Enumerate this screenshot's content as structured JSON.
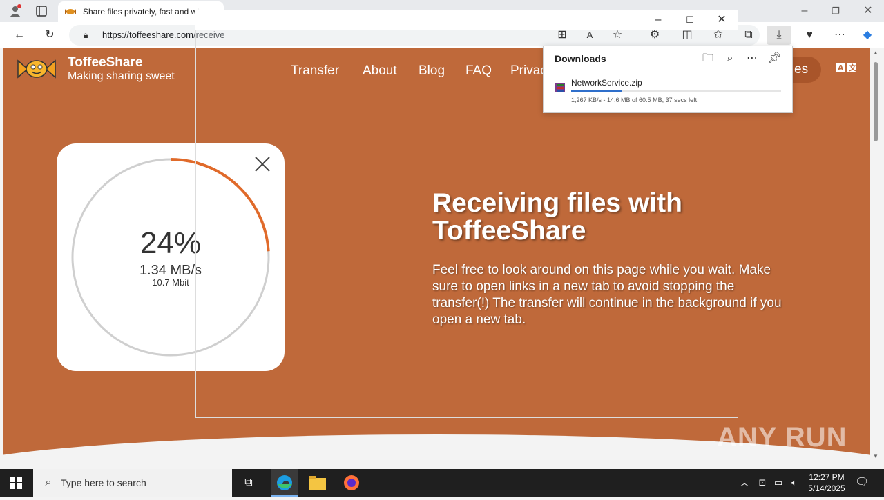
{
  "browser": {
    "tab_title": "Share files privately, fast and wit",
    "url_host": "https://toffeeshare.com",
    "url_path": "/receive"
  },
  "site": {
    "name": "ToffeeShare",
    "tagline": "Making sharing sweet",
    "nav": [
      "Transfer",
      "About",
      "Blog",
      "FAQ",
      "Privac"
    ],
    "nav_partial_right": "es"
  },
  "hero": {
    "title": "Receiving files with ToffeeShare",
    "text": "Feel free to look around on this page while you wait. Make sure to open links in a new tab to avoid stopping the transfer(!) The transfer will continue in the background if you open a new tab."
  },
  "progress_card": {
    "percent_label": "24%",
    "percent_value": 0.24,
    "speed": "1.34 MB/s",
    "mbit": "10.7 Mbit"
  },
  "downloads": {
    "header": "Downloads",
    "file_name": "NetworkService.zip",
    "status": "1,267 KB/s - 14.6 MB of 60.5 MB, 37 secs left",
    "progress": 0.24
  },
  "watermark": "ANY RUN",
  "taskbar": {
    "search_placeholder": "Type here to search",
    "time": "12:27 PM",
    "date": "5/14/2025"
  },
  "colors": {
    "page_bg": "#bf693a",
    "progress_arc": "#e06a2a",
    "download_bar": "#2f6fcb"
  }
}
